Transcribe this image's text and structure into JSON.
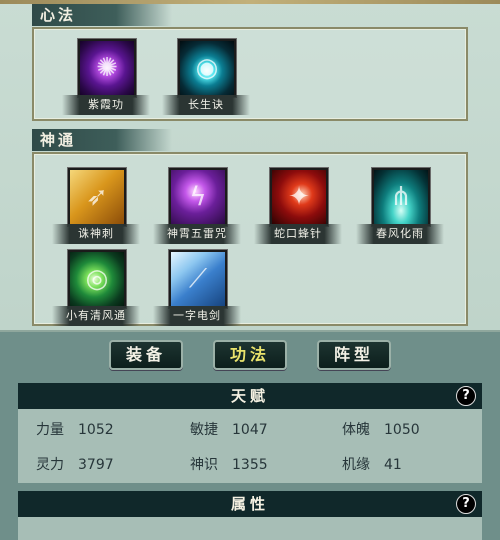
{
  "sections": {
    "xinfa": {
      "title": "心法",
      "skills": [
        {
          "label": "紫霞功",
          "icon": "purple-vortex-icon"
        },
        {
          "label": "长生诀",
          "icon": "cyan-orb-icon"
        }
      ]
    },
    "shentong": {
      "title": "神通",
      "skills": [
        {
          "label": "诛神刺",
          "icon": "golden-spear-icon"
        },
        {
          "label": "神霄五雷咒",
          "icon": "purple-lightning-icon"
        },
        {
          "label": "蛇口蜂针",
          "icon": "red-needle-icon"
        },
        {
          "label": "春风化雨",
          "icon": "teal-rain-icon"
        },
        {
          "label": "小有清风通",
          "icon": "green-wind-icon"
        },
        {
          "label": "一字电剑",
          "icon": "blue-sword-icon"
        }
      ]
    }
  },
  "tabs": [
    {
      "label": "装备",
      "active": false
    },
    {
      "label": "功法",
      "active": true
    },
    {
      "label": "阵型",
      "active": false
    }
  ],
  "talent": {
    "title": "天赋",
    "help": "?",
    "stats": [
      {
        "label": "力量",
        "value": "1052"
      },
      {
        "label": "敏捷",
        "value": "1047"
      },
      {
        "label": "体魄",
        "value": "1050"
      },
      {
        "label": "灵力",
        "value": "3797"
      },
      {
        "label": "神识",
        "value": "1355"
      },
      {
        "label": "机缘",
        "value": "41"
      }
    ]
  },
  "attributes": {
    "title": "属性",
    "help": "?"
  },
  "colors": {
    "active_tab_text": "#e9e36c",
    "panel_title_bg": "#10282a",
    "panel_body_bg": "#a7beb6"
  }
}
